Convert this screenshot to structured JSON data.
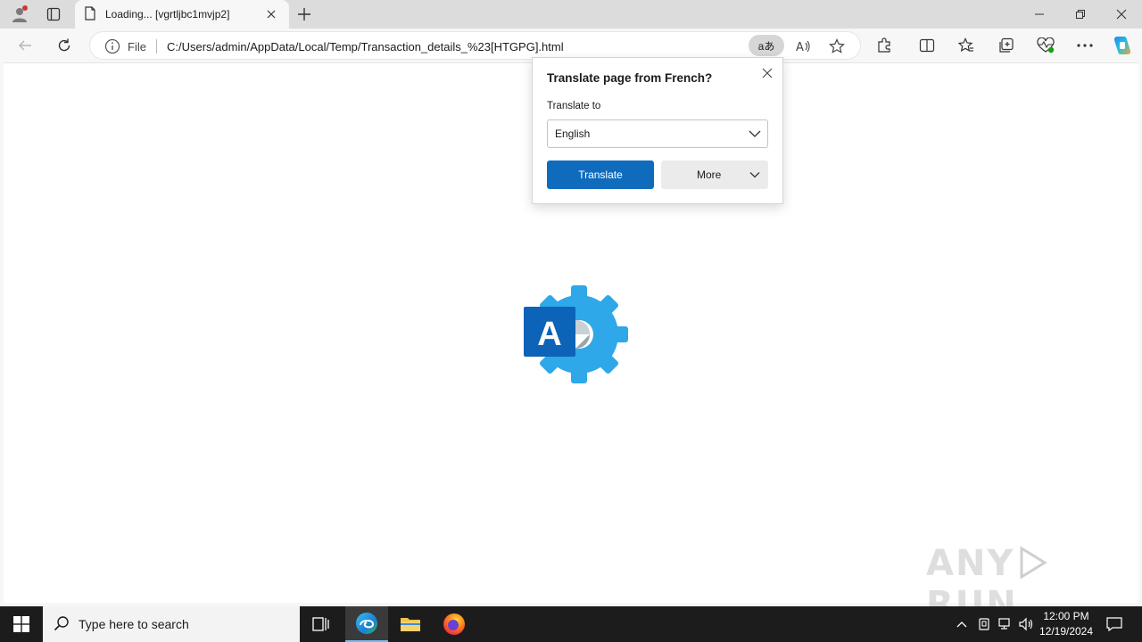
{
  "browser": {
    "tab_title": "Loading... [vgrtljbc1mvjp2]",
    "address": {
      "scheme_label": "File",
      "url": "C:/Users/admin/AppData/Local/Temp/Transaction_details_%23[HTGPG].html",
      "translate_glyph": "aあ"
    }
  },
  "translate_popup": {
    "title": "Translate page from French?",
    "translate_to_label": "Translate to",
    "selected_language": "English",
    "translate_button": "Translate",
    "more_button": "More"
  },
  "page": {
    "logo_letter": "A",
    "watermark_left": "ANY",
    "watermark_right": "RUN"
  },
  "taskbar": {
    "search_placeholder": "Type here to search",
    "time": "12:00 PM",
    "date": "12/19/2024"
  },
  "colors": {
    "accent": "#0f6cbd",
    "gear": "#2ea8e8",
    "tile": "#0d63b8"
  }
}
